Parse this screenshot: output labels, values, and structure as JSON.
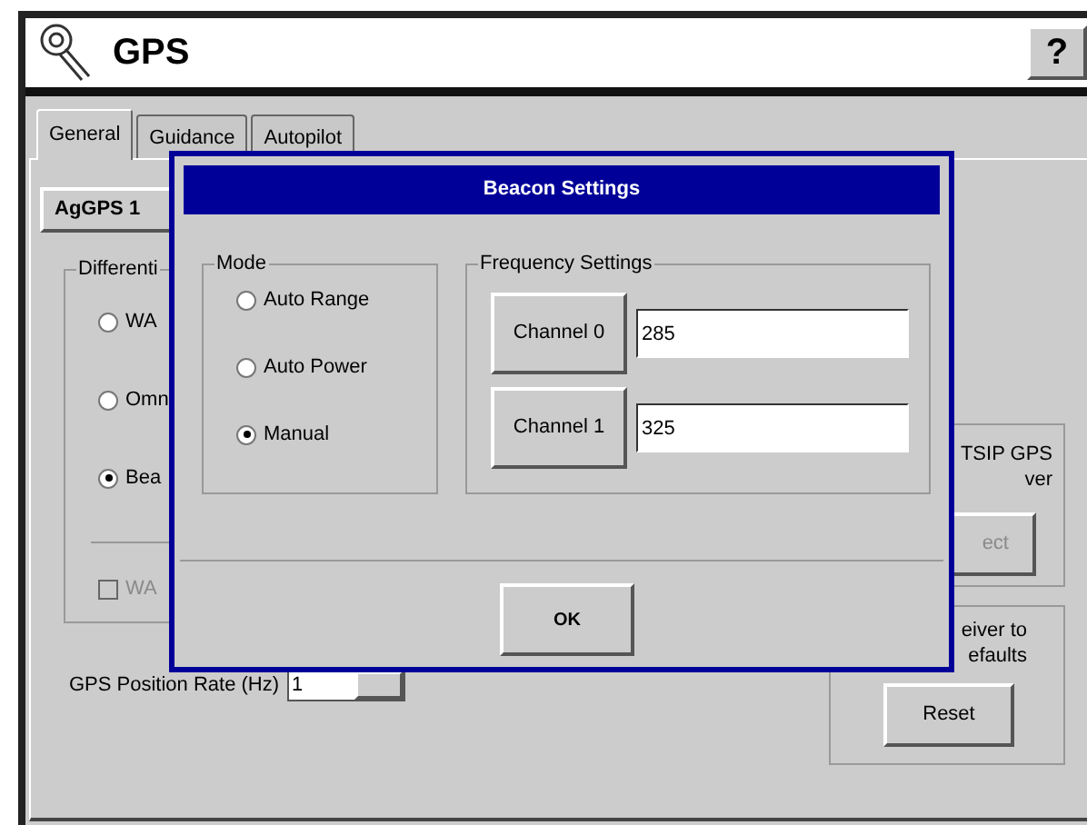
{
  "window": {
    "title": "GPS",
    "help": "?"
  },
  "tabs": [
    {
      "label": "General",
      "selected": true
    },
    {
      "label": "Guidance",
      "selected": false
    },
    {
      "label": "Autopilot",
      "selected": false
    }
  ],
  "background": {
    "receiver_button": "AgGPS 1",
    "differential_group": {
      "legend": "Differenti",
      "options": [
        {
          "label": "WA",
          "selected": false
        },
        {
          "label": "Omn",
          "selected": false
        },
        {
          "label": "Bea",
          "selected": true
        }
      ],
      "checkbox": {
        "label": "WA",
        "checked": false,
        "disabled": true
      }
    },
    "position_rate": {
      "label": "GPS Position Rate (Hz)",
      "value": "1"
    },
    "tsip_group": {
      "lines": [
        "TSIP GPS",
        "ver"
      ],
      "button": "ect",
      "disabled": true
    },
    "reset_group": {
      "lines": [
        "eiver to",
        "efaults"
      ],
      "button": "Reset"
    }
  },
  "dialog": {
    "title": "Beacon Settings",
    "mode": {
      "legend": "Mode",
      "options": [
        {
          "label": "Auto Range",
          "selected": false
        },
        {
          "label": "Auto Power",
          "selected": false
        },
        {
          "label": "Manual",
          "selected": true
        }
      ]
    },
    "frequency": {
      "legend": "Frequency Settings",
      "channels": [
        {
          "button": "Channel 0",
          "value": "285"
        },
        {
          "button": "Channel 1",
          "value": "325"
        }
      ]
    },
    "ok": "OK"
  }
}
